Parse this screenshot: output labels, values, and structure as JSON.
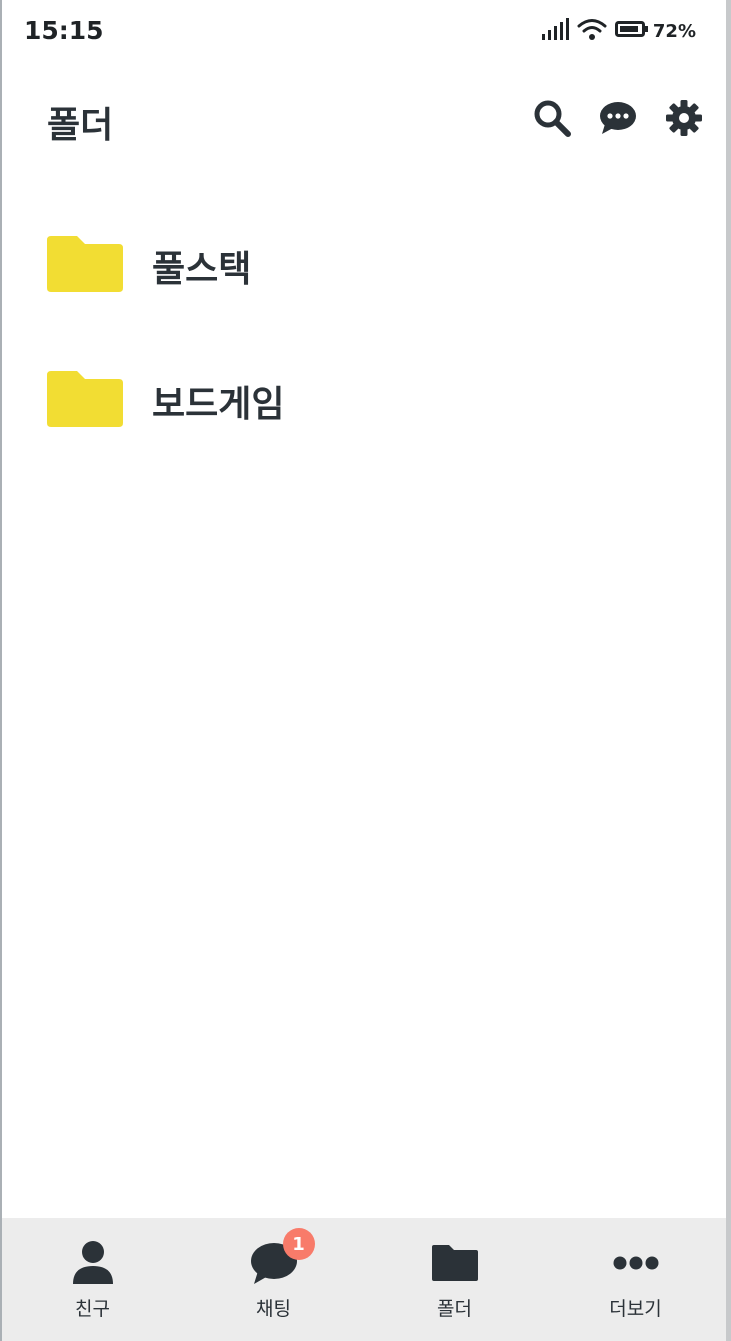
{
  "status_bar": {
    "time": "15:15",
    "battery_percent": "72%",
    "icons": [
      "signal-icon",
      "wifi-icon",
      "battery-icon"
    ]
  },
  "header": {
    "title": "폴더",
    "icons": [
      "search-icon",
      "chat-bubble-icon",
      "gear-icon"
    ]
  },
  "folders": [
    {
      "name": "풀스택",
      "icon": "folder-icon",
      "color": "#f2dd33"
    },
    {
      "name": "보드게임",
      "icon": "folder-icon",
      "color": "#f2dd33"
    }
  ],
  "bottom_nav": {
    "items": [
      {
        "label": "친구",
        "icon": "person-icon"
      },
      {
        "label": "채팅",
        "icon": "chat-icon",
        "badge": "1"
      },
      {
        "label": "폴더",
        "icon": "folder-icon"
      },
      {
        "label": "더보기",
        "icon": "more-dots-icon"
      }
    ],
    "badge_color": "#f87b6a"
  },
  "colors": {
    "text": "#2b3238",
    "folder": "#f2dd33",
    "nav_background": "#ececec"
  }
}
